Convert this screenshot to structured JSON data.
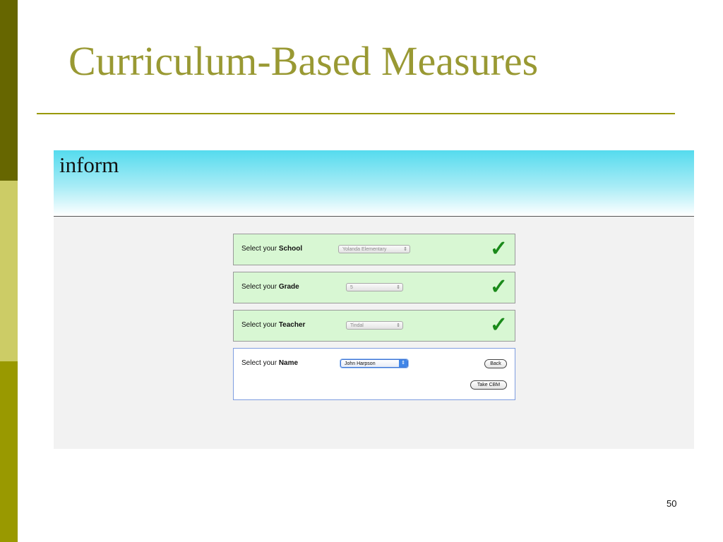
{
  "slide": {
    "title": "Curriculum-Based Measures",
    "page_number": "50"
  },
  "app": {
    "logo": "inform",
    "steps": [
      {
        "prefix": "Select your ",
        "field": "School",
        "value": "Yolanda Elementary",
        "completed": true
      },
      {
        "prefix": "Select your ",
        "field": "Grade",
        "value": "5",
        "completed": true
      },
      {
        "prefix": "Select your ",
        "field": "Teacher",
        "value": "Tindal",
        "completed": true
      },
      {
        "prefix": "Select your ",
        "field": "Name",
        "value": "John Harpson",
        "completed": false
      }
    ],
    "check_glyph": "✓",
    "select_arrows": "⇕",
    "buttons": {
      "back": "Back",
      "take_cbm": "Take CBM"
    }
  },
  "colors": {
    "title": "#999933",
    "rule": "#999900",
    "header_top": "#55dbee",
    "panel_done": "#d8f7d3",
    "check": "#1a8a1a"
  }
}
